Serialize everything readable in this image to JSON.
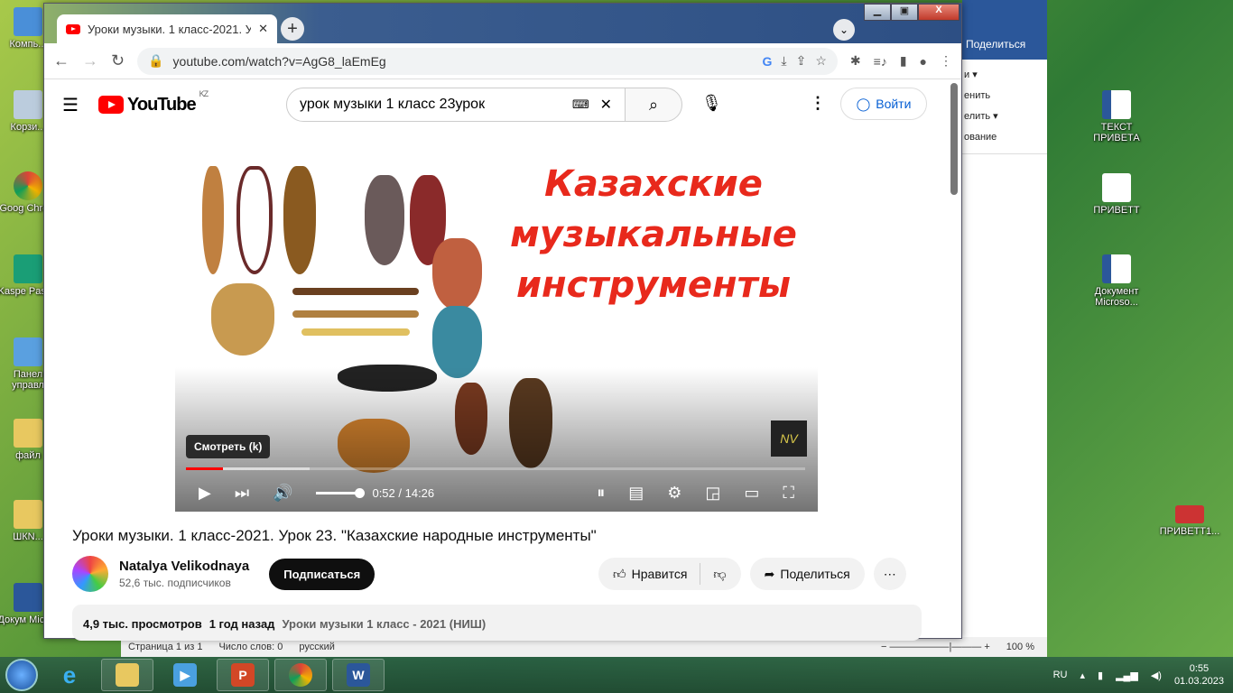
{
  "desktop": {
    "left_icons": [
      "Компь...",
      "Корзи...",
      "Goog Chrom",
      "Kaspe Passw",
      "Панел управл",
      "файл",
      "ШКN...",
      "Докум Micros"
    ],
    "right_icons": [
      "ТЕКСТ ПРИВЕТА",
      "ПРИВЕТТ",
      "Документ Microso...",
      "ПРИВЕТТ1..."
    ]
  },
  "word": {
    "share": "Поделиться",
    "ribbon": [
      "и ▾",
      "енить",
      "елить ▾",
      "ование"
    ],
    "status": {
      "page": "Страница 1 из 1",
      "words": "Число слов: 0",
      "lang": "русский",
      "zoom": "100 %"
    }
  },
  "chrome": {
    "tab_title": "Уроки музыки. 1 класс-2021. Уро",
    "url": "youtube.com/watch?v=AgG8_laEmEg"
  },
  "youtube": {
    "logo": "YouTube",
    "region": "KZ",
    "search_value": "урок музыки 1 класс 23урок",
    "login": "Войти",
    "player": {
      "overlay_title": "Казахские музыкальные инструменты",
      "tooltip": "Смотреть (k)",
      "watermark": "NV",
      "current_time": "0:52",
      "duration": "14:26",
      "time_display": "0:52 / 14:26",
      "progress_percent": 6,
      "buffered_percent": 20,
      "volume_percent": 100,
      "brand_color": "#ff0000"
    },
    "video_title": "Уроки музыки. 1 класс-2021. Урок 23. \"Казахские народные инструменты\"",
    "channel": {
      "name": "Natalya Velikodnaya",
      "subscribers": "52,6 тыс. подписчиков",
      "subscribe": "Подписаться"
    },
    "actions": {
      "like": "Нравится",
      "share": "Поделиться"
    },
    "desc": {
      "views": "4,9 тыс. просмотров",
      "ago": "1 год назад",
      "playlist": "Уроки музыки 1 класс - 2021 (НИШ)"
    }
  },
  "taskbar": {
    "lang": "RU",
    "time": "0:55",
    "date": "01.03.2023"
  }
}
